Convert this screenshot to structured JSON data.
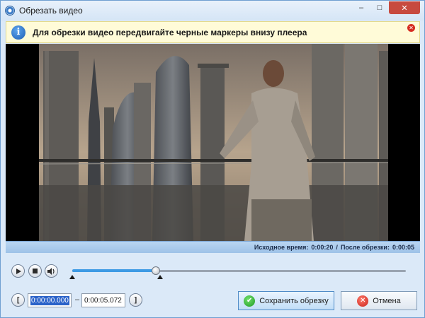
{
  "window": {
    "title": "Обрезать видео",
    "controls": {
      "minimize": "–",
      "maximize": "□",
      "close": "✕"
    }
  },
  "info": {
    "message": "Для обрезки видео передвигайте черные маркеры внизу плеера",
    "close": "✕"
  },
  "status": {
    "source_label": "Исходное время:",
    "source_value": "0:00:20",
    "separator": "/",
    "after_label": "После обрезки:",
    "after_value": "0:00:05"
  },
  "player": {
    "position_fraction": 0.25
  },
  "trim": {
    "start_bracket": "[",
    "start_time": "0:00:00.000",
    "dash": "–",
    "end_time": "0:00:05.072",
    "end_bracket": "]"
  },
  "actions": {
    "save_label": "Сохранить обрезку",
    "cancel_label": "Отмена"
  },
  "colors": {
    "accent": "#3d9ae4",
    "titlebar": "#d5e5f6",
    "infobar": "#fffbd8"
  }
}
